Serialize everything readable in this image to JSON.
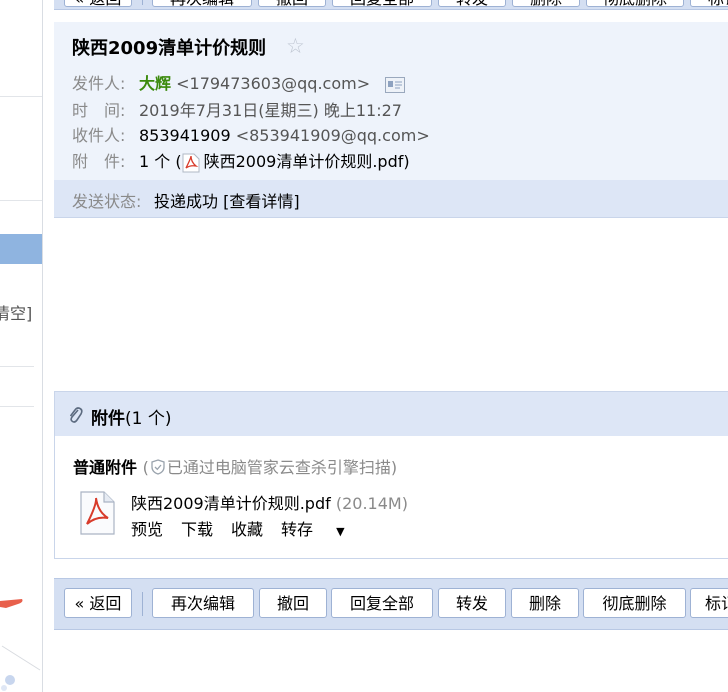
{
  "sidebar": {
    "clear_text": "清空]"
  },
  "email": {
    "subject": "陕西2009清单计价规则",
    "sender_label": "发件人:",
    "sender_name": "大辉",
    "sender_email": "<179473603@qq.com>",
    "time_label": "时　间:",
    "time_value": "2019年7月31日(星期三) 晚上11:27",
    "recipient_label": "收件人:",
    "recipient_name": "853941909",
    "recipient_email": "<853941909@qq.com>",
    "attachment_label": "附　件:",
    "attachment_count": "1 个 (",
    "attachment_name": "陕西2009清单计价规则.pdf",
    "attachment_close": ")",
    "status_label": "发送状态:",
    "status_value": "投递成功",
    "status_detail": "[查看详情]"
  },
  "attachments": {
    "title": "附件",
    "count": "(1 个)",
    "section_label": "普通附件",
    "scan_open": "(",
    "scan_note": "已通过电脑管家云查杀引擎扫描",
    "scan_close": ")",
    "file": {
      "name": "陕西2009清单计价规则.pdf",
      "size": "(20.14M)",
      "actions": [
        "预览",
        "下载",
        "收藏",
        "转存"
      ]
    }
  },
  "toolbar": {
    "back": "« 返回",
    "reedit": "再次编辑",
    "recall": "撤回",
    "reply_all": "回复全部",
    "forward": "转发",
    "delete": "删除",
    "delete_forever": "彻底删除",
    "mark": "标记"
  },
  "colors": {
    "sender_name": "#3b8a0c",
    "toolbar_bg": "#d4dff2",
    "header_bg": "#eef3fb"
  }
}
